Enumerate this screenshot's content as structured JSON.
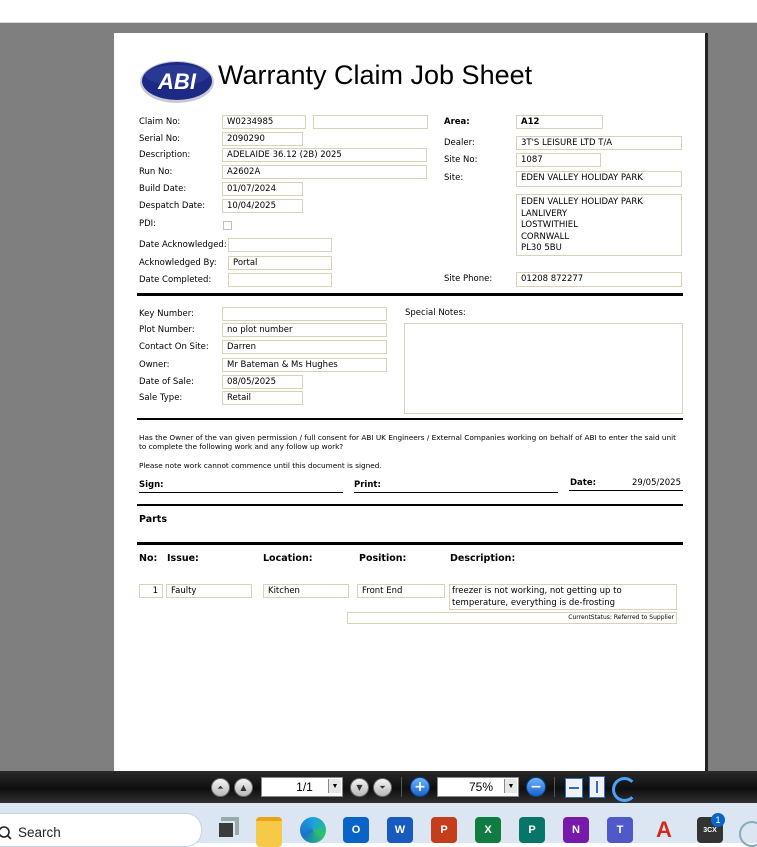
{
  "doc": {
    "logo_text": "ABI",
    "title": "Warranty Claim Job Sheet",
    "left_fields": [
      {
        "label": "Claim No:",
        "value": "W0234985"
      },
      {
        "label": "Serial No:",
        "value": "2090290"
      },
      {
        "label": "Description:",
        "value": "ADELAIDE 36.12 (2B) 2025"
      },
      {
        "label": "Run No:",
        "value": "A2602A"
      },
      {
        "label": "Build Date:",
        "value": "01/07/2024"
      },
      {
        "label": "Despatch Date:",
        "value": "10/04/2025"
      },
      {
        "label": "PDI:",
        "value": ""
      },
      {
        "label": "Date Acknowledged:",
        "value": ""
      },
      {
        "label": "Acknowledged By:",
        "value": "Portal"
      },
      {
        "label": "Date Completed:",
        "value": ""
      }
    ],
    "right_fields": {
      "area_label": "Area:",
      "area": "A12",
      "dealer_label": "Dealer:",
      "dealer": "3T'S LEISURE LTD T/A",
      "site_no_label": "Site No:",
      "site_no": "1087",
      "site_label": "Site:",
      "site": "EDEN VALLEY HOLIDAY PARK",
      "address": [
        "EDEN VALLEY HOLIDAY PARK",
        "LANLIVERY",
        "LOSTWITHIEL",
        "CORNWALL",
        "PL30 5BU"
      ],
      "site_phone_label": "Site Phone:",
      "site_phone": "01208 872277"
    },
    "owner_fields": [
      {
        "label": "Key Number:",
        "value": ""
      },
      {
        "label": "Plot Number:",
        "value": "no plot number"
      },
      {
        "label": "Contact On Site:",
        "value": "Darren"
      },
      {
        "label": "Owner:",
        "value": "Mr Bateman & Ms Hughes"
      },
      {
        "label": "Date of Sale:",
        "value": "08/05/2025"
      },
      {
        "label": "Sale Type:",
        "value": "Retail"
      }
    ],
    "special_notes_label": "Special Notes:",
    "consent_line1": "Has the Owner of the van given permission / full consent for ABI UK Engineers / External Companies working on behalf of ABI to enter the said unit",
    "consent_line2": "to complete the following work and any follow up work?",
    "note": "Please note work cannot commence until this document is signed.",
    "sign_label": "Sign:",
    "print_label": "Print:",
    "date_label": "Date:",
    "date_value": "29/05/2025",
    "parts_label": "Parts",
    "columns": [
      "No:",
      "Issue:",
      "Location:",
      "Position:",
      "Description:"
    ],
    "row": {
      "no": "1",
      "issue": "Faulty",
      "location": "Kitchen",
      "position": "Front End",
      "description": "freezer is not working, not getting up to temperature, everything is de-frosting",
      "status": "CurrentStatus: Referred to Supplier"
    }
  },
  "toolbar": {
    "page": "1/1",
    "zoom": "75%",
    "icons": [
      "first-page-icon",
      "prev-page-icon",
      "next-page-icon",
      "last-page-icon",
      "zoom-in-icon",
      "zoom-out-icon",
      "fit-width-icon",
      "fit-page-icon",
      "rotate-icon"
    ]
  },
  "taskbar": {
    "search_label": "Search",
    "apps": [
      "Task View",
      "File Explorer",
      "Edge",
      "Outlook",
      "Word",
      "PowerPoint",
      "Excel",
      "Publisher",
      "OneNote",
      "Teams",
      "Acrobat",
      "App"
    ],
    "badge": "1",
    "colors": {
      "word": "#185abd",
      "excel": "#107c41",
      "powerpoint": "#c43e1c",
      "outlook": "#0a64c8",
      "onenote": "#7719aa",
      "publisher": "#077568",
      "teams": "#5059c9",
      "acrobat": "#d4281e"
    }
  }
}
